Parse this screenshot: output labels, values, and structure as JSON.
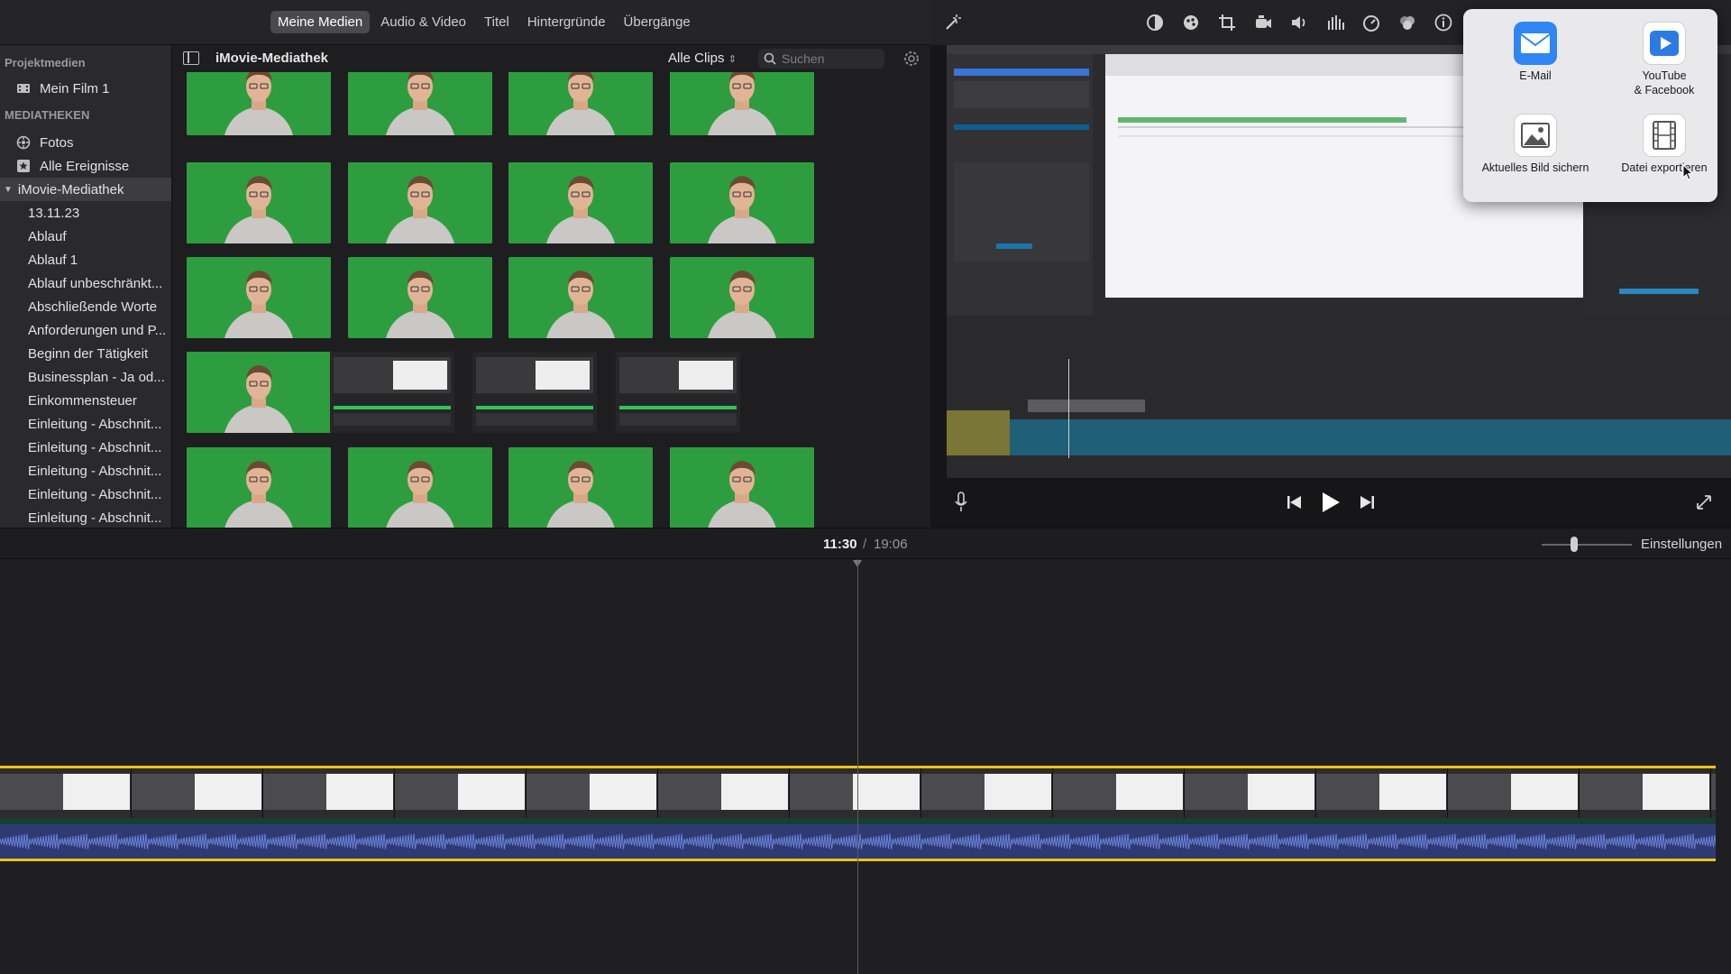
{
  "tabs": [
    "Meine Medien",
    "Audio & Video",
    "Titel",
    "Hintergründe",
    "Übergänge"
  ],
  "sidebar": {
    "project_header": "Projektmedien",
    "project_item": "Mein Film 1",
    "libraries_header": "MEDIATHEKEN",
    "fotos": "Fotos",
    "all_events": "Alle Ereignisse",
    "library": "iMovie-Mediathek",
    "events": [
      "13.11.23",
      "Ablauf",
      "Ablauf 1",
      "Ablauf unbeschränkt...",
      "Abschließende Worte",
      "Anforderungen und P...",
      "Beginn der Tätigkeit",
      "Businessplan - Ja od...",
      "Einkommensteuer",
      "Einleitung - Abschnit...",
      "Einleitung - Abschnit...",
      "Einleitung - Abschnit...",
      "Einleitung - Abschnit...",
      "Einleitung - Abschnit..."
    ]
  },
  "browser": {
    "title": "iMovie-Mediathek",
    "filter": "Alle Clips",
    "search_placeholder": "Suchen"
  },
  "share": {
    "email": "E-Mail",
    "youtube_line1": "YouTube",
    "youtube_line2": "& Facebook",
    "save_image": "Aktuelles Bild sichern",
    "export_file": "Datei exportieren"
  },
  "timeline": {
    "current_time": "11:30",
    "separator": "/",
    "total_time": "19:06",
    "settings": "Einstellungen"
  },
  "colors": {
    "accent_yellow": "#f2c216",
    "green_screen": "#2d9a3d",
    "audio_blue": "#2e3b72"
  }
}
